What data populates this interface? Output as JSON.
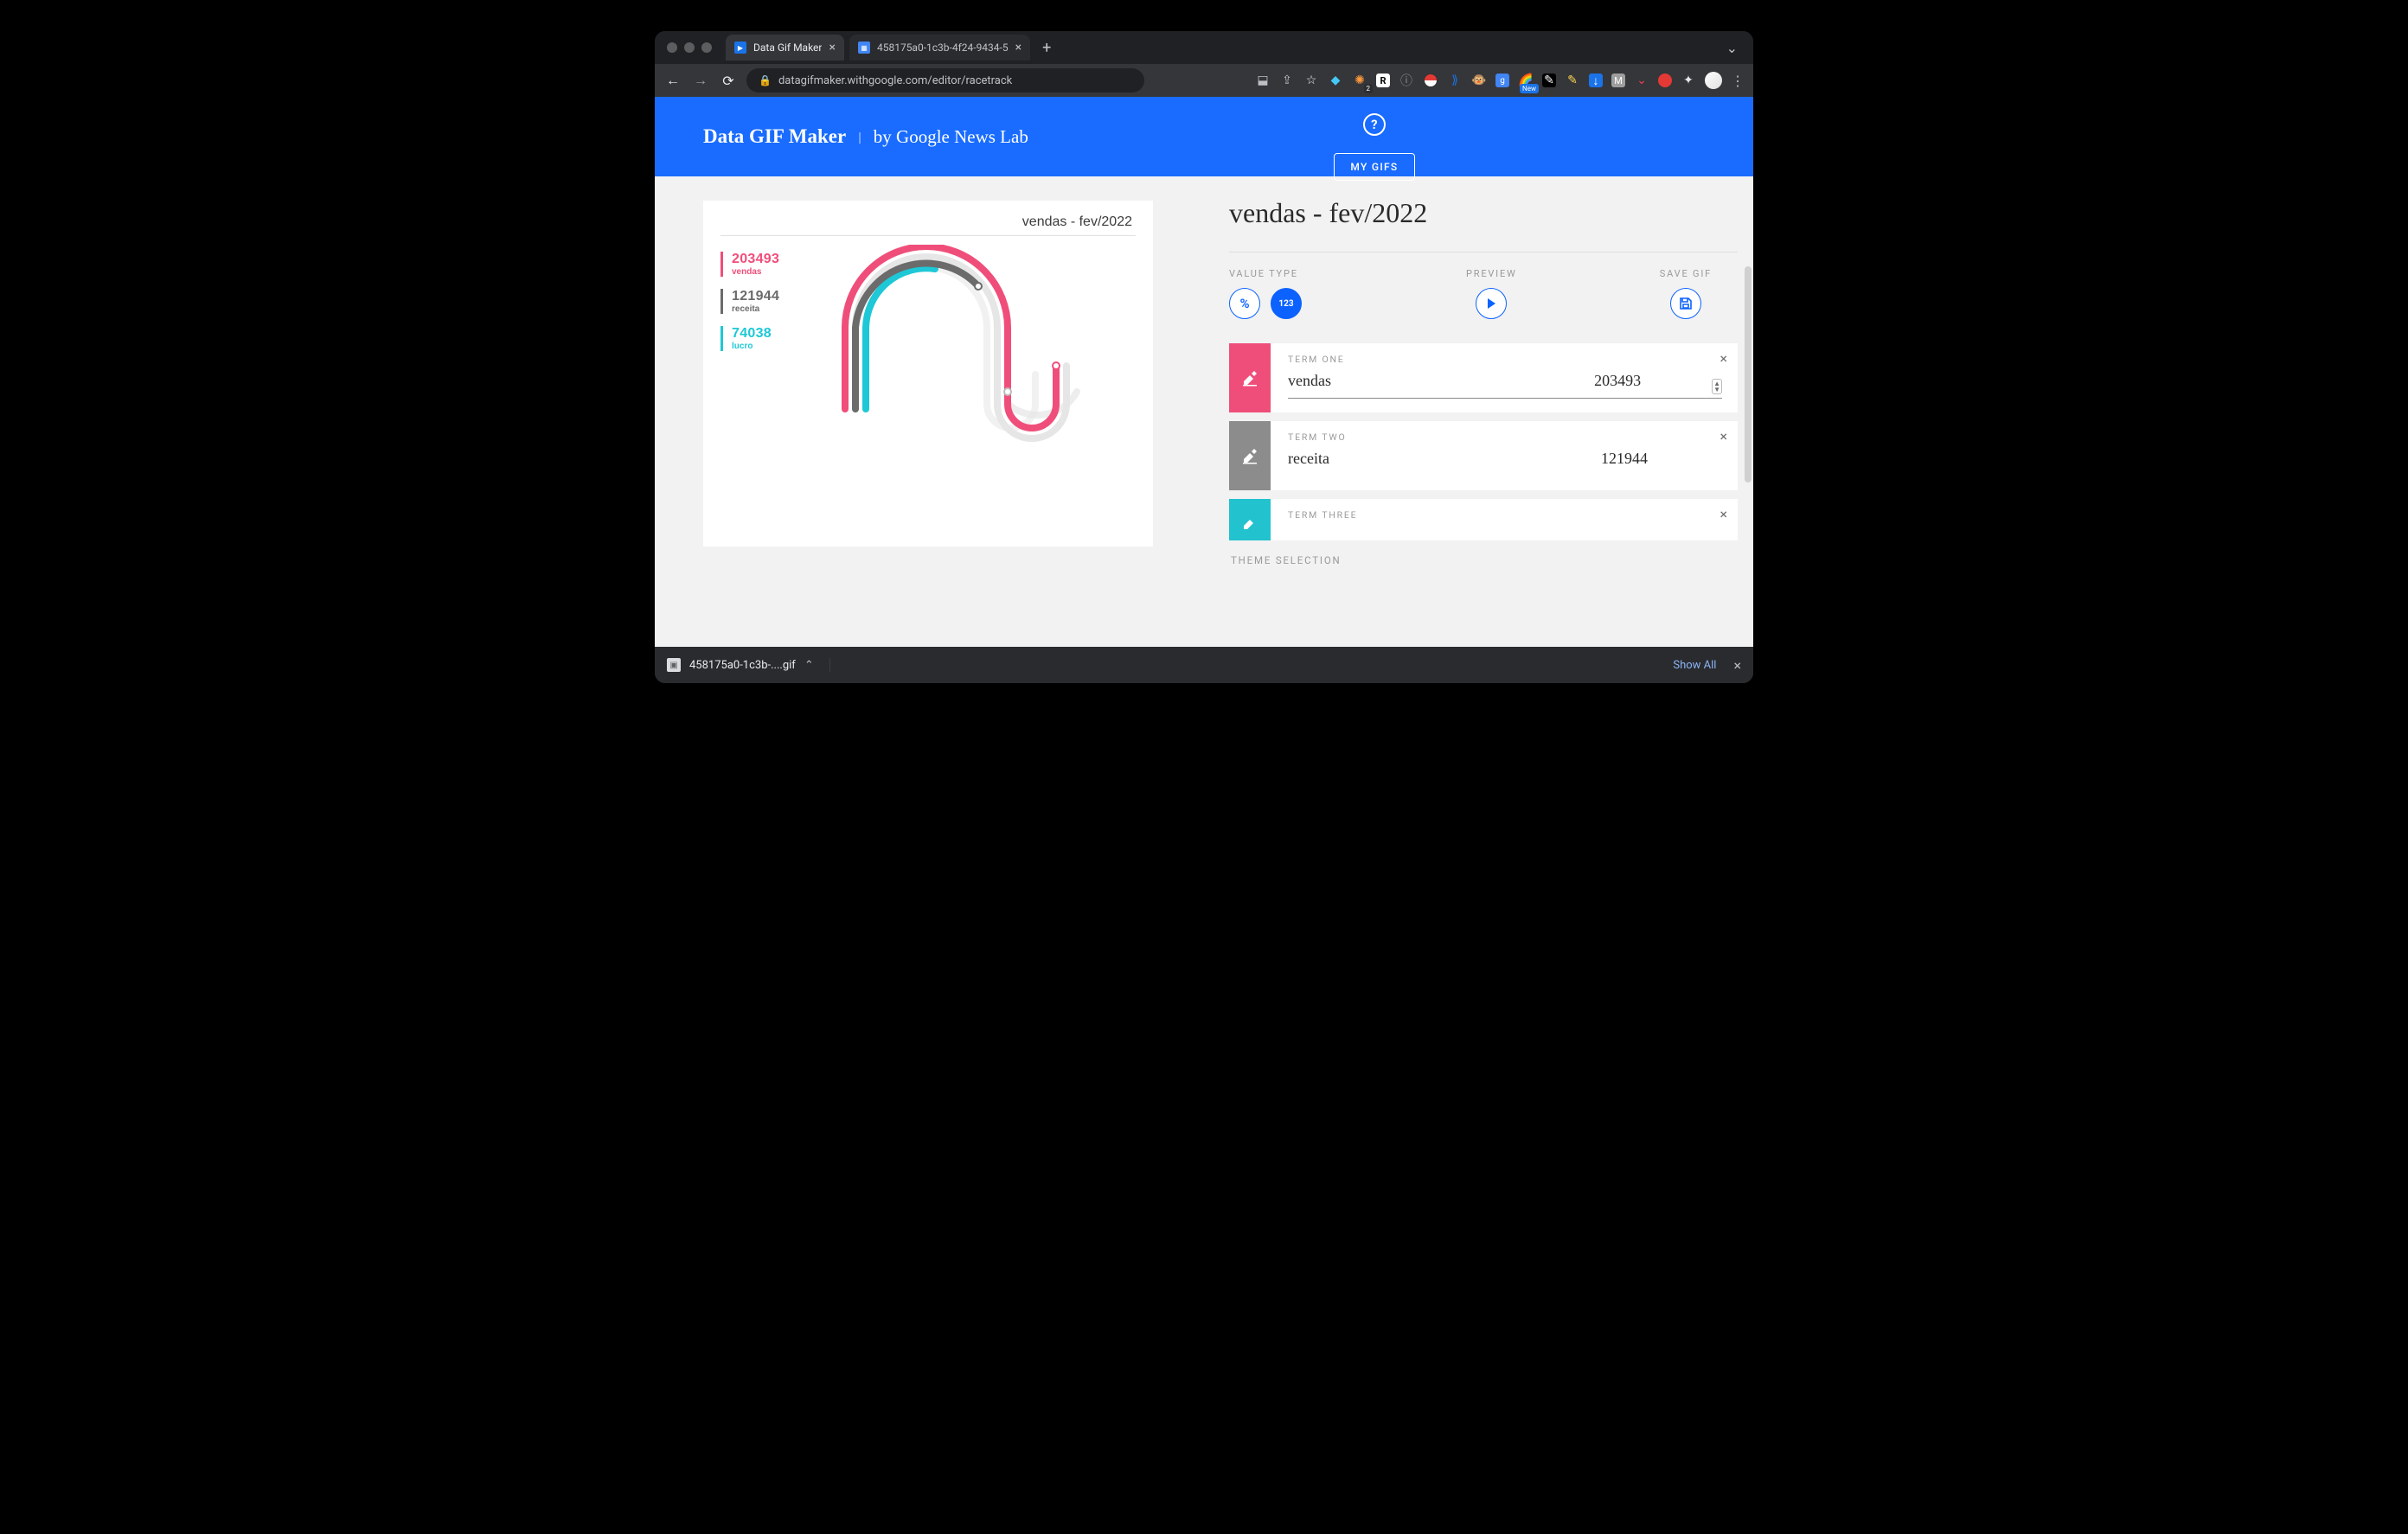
{
  "browser": {
    "tab1": "Data Gif Maker",
    "tab2": "458175a0-1c3b-4f24-9434-5",
    "url": "datagifmaker.withgoogle.com/editor/racetrack"
  },
  "header": {
    "brand": "Data GIF Maker",
    "byline": "by Google News Lab",
    "mygifs": "MY GIFS"
  },
  "title": "vendas - fev/2022",
  "preview_title": "vendas - fev/2022",
  "labels": {
    "value_type": "VALUE TYPE",
    "preview": "PREVIEW",
    "save": "SAVE GIF",
    "pct": "%",
    "num": "123",
    "term1": "TERM ONE",
    "term2": "TERM TWO",
    "term3": "TERM THREE",
    "theme": "THEME SELECTION"
  },
  "terms": {
    "t1": {
      "name": "vendas",
      "value": "203493"
    },
    "t2": {
      "name": "receita",
      "value": "121944"
    },
    "t3": {
      "name": "lucro",
      "value": "74038"
    }
  },
  "chart_data": {
    "type": "bar",
    "title": "vendas - fev/2022",
    "categories": [
      "vendas",
      "receita",
      "lucro"
    ],
    "values": [
      203493,
      121944,
      74038
    ],
    "series_colors": [
      "#f04e7a",
      "#6b6b6b",
      "#1ec8d6"
    ],
    "xlabel": "",
    "ylabel": ""
  },
  "downloads": {
    "file": "458175a0-1c3b-....gif",
    "showall": "Show All"
  }
}
